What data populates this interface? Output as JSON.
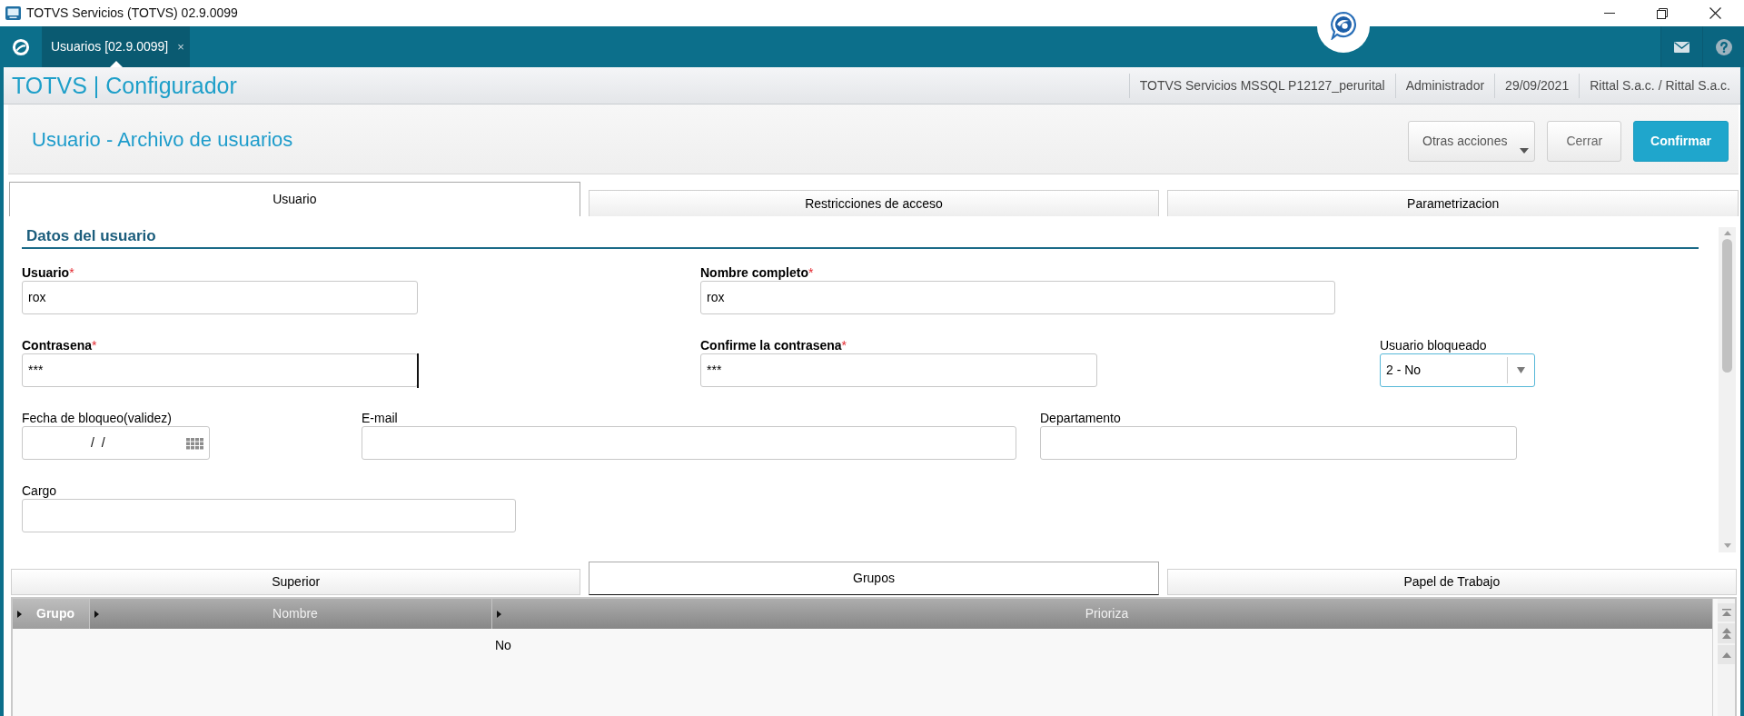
{
  "window": {
    "title": "TOTVS Servicios (TOTVS) 02.9.0099"
  },
  "app_bar": {
    "tabs": [
      {
        "label": "Usuarios [02.9.0099]",
        "close": "×",
        "selected": true
      }
    ]
  },
  "header": {
    "title": "TOTVS | Configurador",
    "info": [
      "TOTVS Servicios MSSQL P12127_perurital",
      "Administrador",
      "29/09/2021",
      "Rittal S.a.c. / Rittal S.a.c."
    ]
  },
  "page": {
    "title": "Usuario - Archivo de usuarios",
    "actions": [
      {
        "label": "Otras acciones",
        "kind": "menu"
      },
      {
        "label": "Cerrar",
        "kind": "secondary"
      },
      {
        "label": "Confirmar",
        "kind": "primary"
      }
    ]
  },
  "tabs": [
    {
      "label": "Usuario",
      "selected": true
    },
    {
      "label": "Restricciones de acceso",
      "selected": false
    },
    {
      "label": "Parametrizacion",
      "selected": false
    }
  ],
  "form": {
    "section": "Datos del usuario",
    "rows": [
      [
        {
          "label": "Usuario",
          "required": true,
          "marker": "*",
          "kind": "text",
          "value": "rox",
          "focused": false
        },
        {
          "label": "Nombre completo",
          "required": true,
          "marker": "*",
          "kind": "text",
          "value": "rox",
          "focused": false
        }
      ],
      [
        {
          "label": "Contrasena",
          "required": true,
          "marker": "*",
          "kind": "text",
          "value": "***",
          "focused": true
        },
        {
          "label": "Confirme la contrasena",
          "required": true,
          "marker": "*",
          "kind": "text",
          "value": "***",
          "focused": false
        },
        {
          "label": "Usuario bloqueado",
          "required": false,
          "kind": "select",
          "value": "2 - No",
          "focused": false
        }
      ],
      [
        {
          "label": "Fecha de bloqueo(validez)",
          "required": false,
          "kind": "date",
          "value": "/  /",
          "focused": false
        },
        {
          "label": "E-mail",
          "required": false,
          "kind": "text",
          "focused": false
        },
        {
          "label": "Departamento",
          "required": false,
          "kind": "text",
          "focused": false
        }
      ],
      [
        {
          "label": "Cargo",
          "required": false,
          "kind": "text",
          "focused": false
        }
      ]
    ]
  },
  "detail_tabs": [
    {
      "label": "Superior",
      "selected": false
    },
    {
      "label": "Grupos",
      "selected": true
    },
    {
      "label": "Papel de Trabajo",
      "selected": false
    }
  ],
  "grid": {
    "columns": [
      {
        "label": "Grupo",
        "selected": true
      },
      {
        "label": "Nombre",
        "selected": false
      },
      {
        "label": "Prioriza",
        "selected": false
      }
    ],
    "rows": [
      {
        "cells": [
          null,
          null,
          "No"
        ]
      }
    ]
  }
}
